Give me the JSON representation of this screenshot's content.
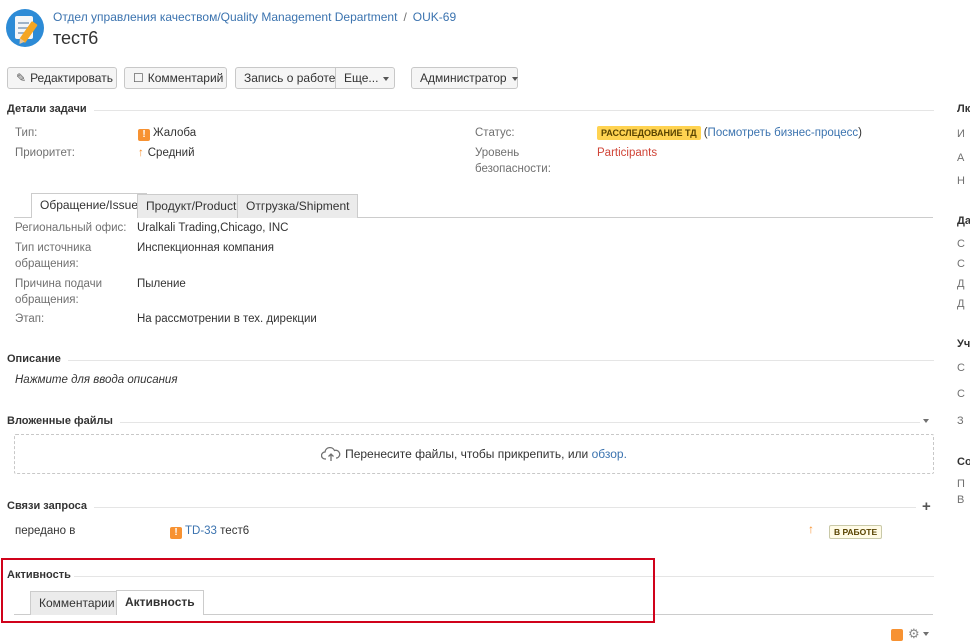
{
  "header": {
    "project_name": "Отдел управления качеством/Quality Management Department",
    "breadcrumb_sep": "/",
    "issue_key": "OUK-69",
    "title": "тест6"
  },
  "toolbar": {
    "edit": "Редактировать",
    "comment": "Комментарий",
    "log_work": "Запись о работе",
    "more": "Еще...",
    "admin": "Администратор"
  },
  "details": {
    "heading": "Детали задачи",
    "type_label": "Тип:",
    "type_value": "Жалоба",
    "priority_label": "Приоритет:",
    "priority_value": "Средний",
    "status_label": "Статус:",
    "status_value": "РАССЛЕДОВАНИЕ ТД",
    "status_link_open": "(",
    "status_link": "Посмотреть бизнес-процесс",
    "status_link_close": ")",
    "security_label_1": "Уровень",
    "security_label_2": "безопасности:",
    "security_value": "Participants"
  },
  "tabs": [
    "Обращение/Issue",
    "Продукт/Product",
    "Отгрузка/Shipment"
  ],
  "issue_fields": {
    "office_label": "Региональный офис:",
    "office_value": "Uralkali Trading,Chicago, INC",
    "source_label_1": "Тип источника",
    "source_label_2": "обращения:",
    "source_value": "Инспекционная компания",
    "reason_label_1": "Причина подачи",
    "reason_label_2": "обращения:",
    "reason_value": "Пыление",
    "stage_label": "Этап:",
    "stage_value": "На рассмотрении в тех. дирекции"
  },
  "description": {
    "heading": "Описание",
    "placeholder": "Нажмите для ввода описания"
  },
  "attachments": {
    "heading": "Вложенные файлы",
    "drop_text": "Перенесите файлы, чтобы прикрепить, или",
    "browse": "обзор."
  },
  "links": {
    "heading": "Связи запроса",
    "relation": "передано в",
    "linked_key": "TD-33",
    "linked_summary": "тест6",
    "linked_status": "В РАБОТЕ"
  },
  "activity": {
    "heading": "Активность",
    "tabs": [
      "Комментарии",
      "Активность"
    ],
    "active_tab": "Активность"
  },
  "right_column": {
    "h1": "Лк",
    "r1": "И",
    "r2": "А",
    "r3": "Н",
    "h2": "Да",
    "r4": "С",
    "r5": "С",
    "r6": "Д",
    "r7": "Д",
    "h3": "Уч",
    "r8": "С",
    "r9": "С",
    "r10": "З",
    "h4": "Со",
    "r11": "П",
    "r12": "В"
  },
  "colors": {
    "link": "#3b73af",
    "status_lozenge": "#ffd351",
    "priority": "#f79232",
    "security": "#d04437",
    "highlight_box": "#d0021b"
  }
}
